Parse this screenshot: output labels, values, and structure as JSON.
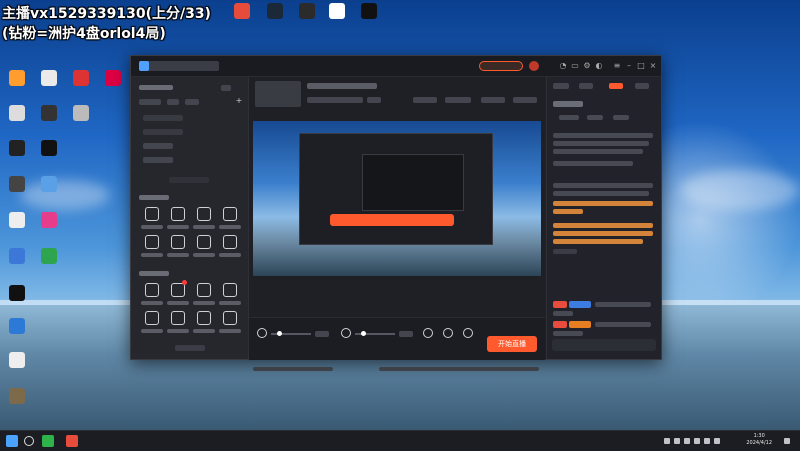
{
  "overlay": {
    "line1": "主播vx1529339130(上分/33)",
    "line2": "(钻粉=洲护4盘orlol4局)"
  },
  "app": {
    "start_live_label": "开始直播"
  },
  "taskbar": {
    "time": "1:30",
    "date": "2024/4/12"
  },
  "colors": {
    "accent": "#ff5a2d",
    "panel": "#26272d",
    "preview_sky": "#3b7fcc"
  }
}
